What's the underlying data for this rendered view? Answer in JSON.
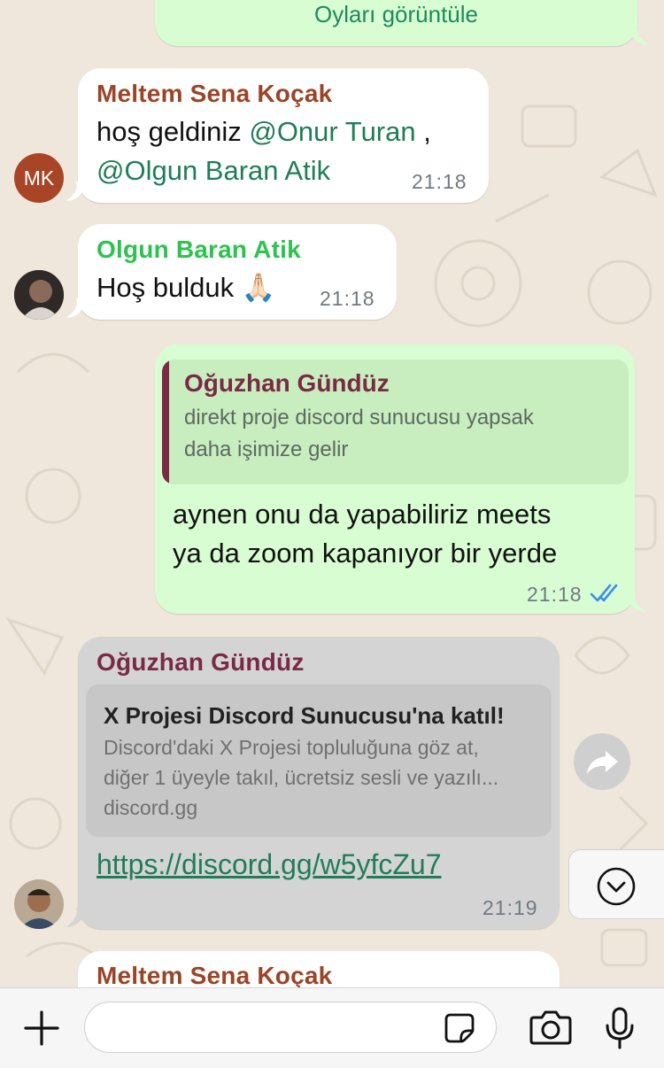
{
  "colors": {
    "chat_background": "#efe7dc",
    "incoming_bubble": "#ffffff",
    "outgoing_bubble": "#d9fdd3",
    "forwarded_bubble": "#d4d4d4",
    "link": "#1f7d5a",
    "read_ticks": "#3b8fe8"
  },
  "poll": {
    "view_votes": "Oyları görüntüle"
  },
  "messages": [
    {
      "sender": "Meltem Sena Koçak",
      "sender_color": "#9c4427",
      "prefix": "hoş geldiniz ",
      "mention1": "@Onur Turan",
      "comma": " ,",
      "mention2": "@Olgun Baran Atik",
      "time": "21:18",
      "avatar_initials": "MK"
    },
    {
      "sender": "Olgun Baran Atik",
      "sender_color": "#2ec24f",
      "text": "Hoş bulduk 🙏🏻",
      "time": "21:18"
    },
    {
      "quote_sender": "Oğuzhan Gündüz",
      "quote_line1": "direkt proje discord sunucusu yapsak",
      "quote_line2": "daha işimize gelir",
      "line1": "aynen onu da yapabiliriz meets",
      "line2": "ya da zoom kapanıyor bir yerde",
      "time": "21:18",
      "status_icon": "double-check-read-icon"
    },
    {
      "sender": "Oğuzhan Gündüz",
      "sender_color": "#7a2a46",
      "preview_title": "X Projesi Discord Sunucusu'na katıl!",
      "preview_desc1": "Discord'daki X Projesi topluluğuna göz at,",
      "preview_desc2": "diğer 1 üyeyle takıl, ücretsiz sesli ve yazılı...",
      "preview_domain": "discord.gg",
      "link": "https://discord.gg/w5yfcZu7",
      "time": "21:19"
    },
    {
      "sender": "Meltem Sena Koçak",
      "sender_color": "#9c4427"
    }
  ],
  "composer": {
    "plus_icon": "plus-icon",
    "sticker_icon": "sticker-icon",
    "camera_icon": "camera-icon",
    "mic_icon": "microphone-icon"
  }
}
